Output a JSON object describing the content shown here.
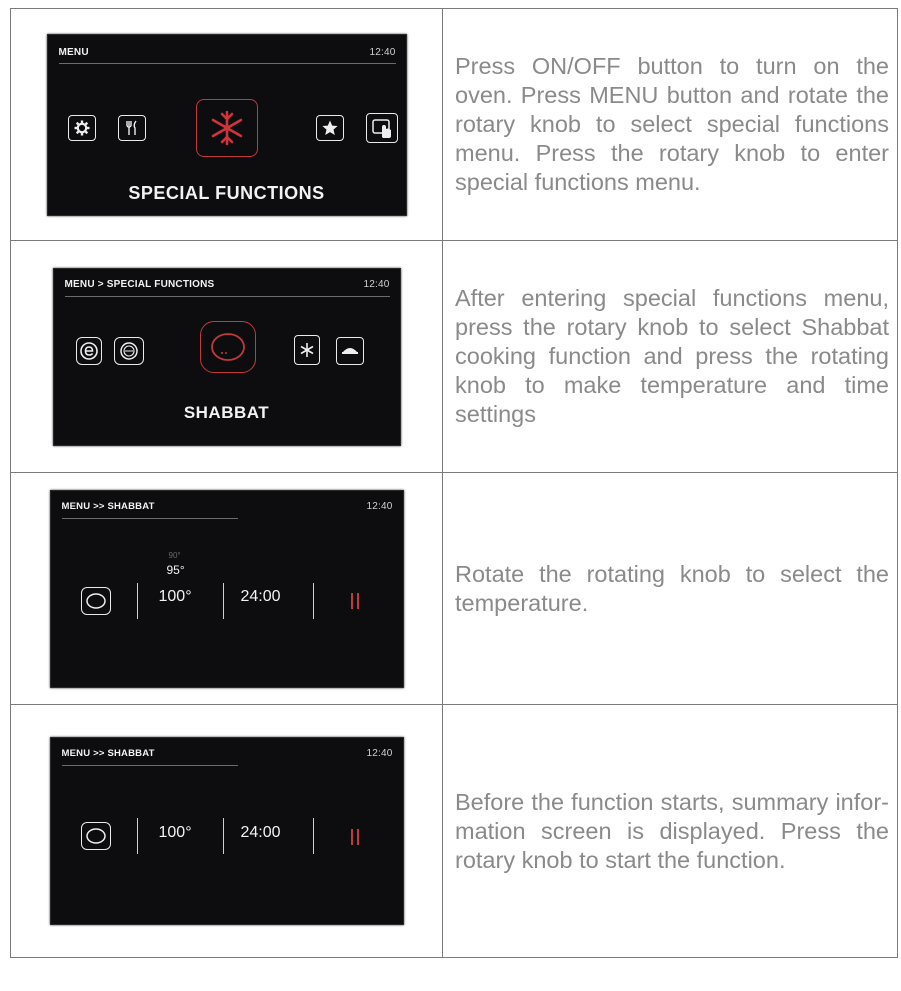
{
  "rows": [
    {
      "screen": {
        "breadcrumb": "MENU",
        "clock": "12:40",
        "title": "SPECIAL FUNCTIONS",
        "icons": [
          "gear-icon",
          "fork-knife-icon",
          "snowflake-selected-icon",
          "star-icon",
          "touch-screen-icon"
        ]
      },
      "text": "Press ON/OFF button to turn on the oven. Press MENU button and rotate the rotary knob to select special functions menu. Press the rotary knob to enter special functions menu."
    },
    {
      "screen": {
        "breadcrumb": "MENU > SPECIAL FUNCTIONS",
        "clock": "12:40",
        "title": "SHABBAT",
        "icons": [
          "eco-icon",
          "pizza-icon",
          "shabbat-selected-icon",
          "defrost-icon",
          "dish-icon"
        ]
      },
      "text": "After entering special functions menu, press the rotary knob to select Shabbat cooking function and press the rotating knob to make temperature and time settings"
    },
    {
      "screen": {
        "breadcrumb": "MENU >> SHABBAT",
        "clock": "12:40",
        "temp_above2": "90°",
        "temp_above1": "95°",
        "temperature": "100°",
        "duration": "24:00",
        "icons": [
          "shabbat-icon",
          "pause-icon"
        ]
      },
      "text": "Rotate the rotating knob to select the temperature."
    },
    {
      "screen": {
        "breadcrumb": "MENU >> SHABBAT",
        "clock": "12:40",
        "temperature": "100°",
        "duration": "24:00",
        "icons": [
          "shabbat-icon",
          "pause-icon"
        ]
      },
      "text": "Before the function starts, summary infor- mation screen is displayed. Press the rotary knob to start the function."
    }
  ],
  "colors": {
    "screen_bg": "#0d0d0f",
    "accent_red": "#c0393b",
    "body_text": "#8a8a8a",
    "border": "#7a7a7a"
  }
}
